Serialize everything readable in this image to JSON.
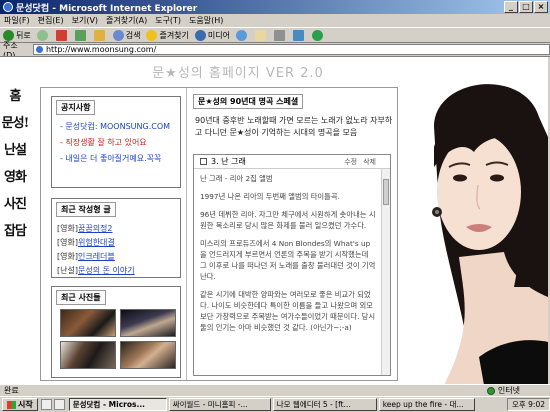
{
  "window": {
    "title": "문성닷컴 - Microsoft Internet Explorer",
    "buttons": [
      "_",
      "□",
      "×"
    ]
  },
  "menu": {
    "items": [
      "파일(F)",
      "편집(E)",
      "보기(V)",
      "즐겨찾기(A)",
      "도구(T)",
      "도움말(H)"
    ]
  },
  "toolbar": {
    "back": "뒤로",
    "search": "검색",
    "favorites": "즐겨찾기",
    "media": "미디어"
  },
  "address": {
    "label": "주소(D)",
    "url": "http://www.moonsung.com/"
  },
  "page": {
    "title": "문★성의 홈페이지 VER 2.0",
    "nav": [
      "홈",
      "문성!",
      "난설",
      "영화",
      "사진",
      "잡담"
    ],
    "notice": {
      "heading": "공지사항",
      "items": [
        {
          "text": "- 문성닷컴: MOONSUNG.COM",
          "color": "blue"
        },
        {
          "text": "- 직장생활 잘 하고 있어요",
          "color": "red"
        },
        {
          "text": "- 내일은 더 좋아질거예요.꼭꼭",
          "color": "blue"
        }
      ]
    },
    "recent": {
      "heading": "최근 작성형 글",
      "items": [
        {
          "tag": "[영화]",
          "title": "꿈꿈의정2"
        },
        {
          "tag": "[영화]",
          "title": "위험한대결"
        },
        {
          "tag": "[영화]",
          "title": "인크레더블"
        },
        {
          "tag": "[난설]",
          "title": "문성의 돈 이야기"
        }
      ]
    },
    "photos": {
      "heading": "최근 사진들"
    },
    "main": {
      "heading": "문★성의 90년대 명곡 스페셜",
      "intro": "90년대 중후반 노래할때 가면 모르는 노래가 없노라 자부하고 다니던 문★성이 기억하는 시대의 명곡을 모음",
      "post": {
        "title": "3. 난 그래",
        "edit": "수정",
        "delete": "삭제",
        "paragraphs": [
          "난 그래 - 리아 2집 앨범",
          "1997년 나온 리아의 두번째 앨범의 타이틀곡.",
          "96년 데뷔한 리아. 자그만 체구에서 시원하게 솟아내는 시원한 목소리로 당시 많은 화제를 불러 일으켰던 가수다.",
          "미스리의 프로듀즈에서 4 Non Blondes의 What's up을 언드러지게 부르면서 언론의 주목을 받기 시작했는데 그 이후로 나를 떠나던 저 노래를 출창 불러대던 것이 기억난다.",
          "같은 시기에 대박한 양파와는 여러모로 좋은 비교가 되었다. 나이도 비슷한데다 특이한 이름을 들고 나왔으며 외모보단 가창력으로 주목받는 여가수들이었기 때문이다. 당시 둘의 인기는 아마 비슷했던 것 같다. (아닌가~;-a)"
        ]
      }
    }
  },
  "status": {
    "left": "완료",
    "zone": "인터넷"
  },
  "taskbar": {
    "start": "시작",
    "tasks": [
      "문성닷컴 - Micros...",
      "싸이월드 - 미니홈피 -...",
      "나모 웹에디터 5 - [ft...",
      "keep up the fire - 대..."
    ],
    "clock": "오후 9:02"
  }
}
